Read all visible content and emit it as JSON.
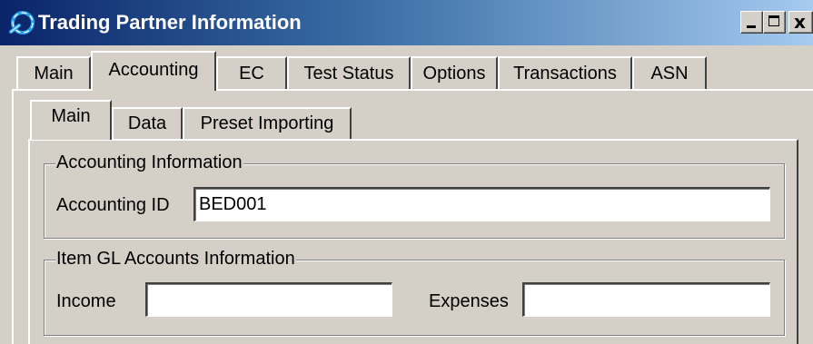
{
  "window": {
    "title": "Trading Partner Information",
    "controls": {
      "minimize": "_",
      "maximize": "□",
      "close": "x"
    },
    "colors": {
      "titlebar_start": "#0a246a",
      "titlebar_end": "#a6caf0",
      "face": "#d4d0c8"
    }
  },
  "outer_tabs": [
    {
      "label": "Main",
      "active": false
    },
    {
      "label": "Accounting",
      "active": true
    },
    {
      "label": "EC",
      "active": false
    },
    {
      "label": "Test Status",
      "active": false
    },
    {
      "label": "Options",
      "active": false
    },
    {
      "label": "Transactions",
      "active": false
    },
    {
      "label": "ASN",
      "active": false
    }
  ],
  "inner_tabs": [
    {
      "label": "Main",
      "active": true
    },
    {
      "label": "Data",
      "active": false
    },
    {
      "label": "Preset Importing",
      "active": false
    }
  ],
  "accounting_info": {
    "group_label": "Accounting Information",
    "accounting_id_label": "Accounting ID",
    "accounting_id_value": "BED001"
  },
  "item_gl": {
    "group_label": "Item GL Accounts Information",
    "income_label": "Income",
    "income_value": "",
    "expenses_label": "Expenses",
    "expenses_value": ""
  }
}
